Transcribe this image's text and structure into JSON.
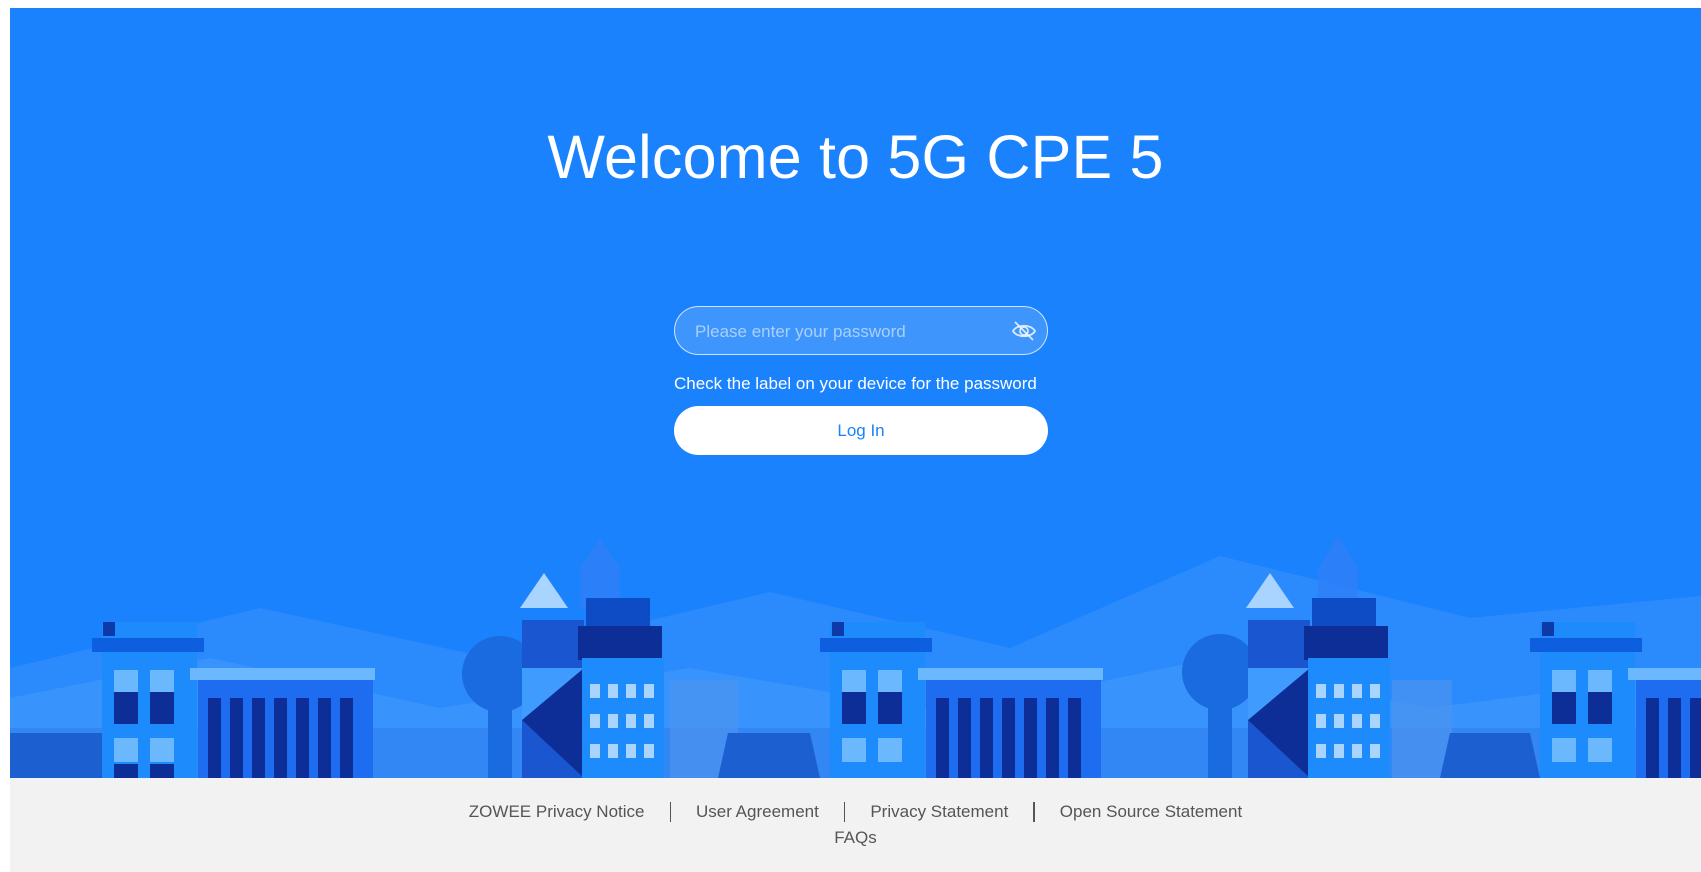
{
  "hero": {
    "title": "Welcome to 5G CPE 5",
    "background_color": "#1a82fc"
  },
  "login_form": {
    "password_placeholder": "Please enter your password",
    "password_value": "",
    "toggle_icon": "eye-slash-icon",
    "hint": "Check the label on your device for the password",
    "login_label": "Log In"
  },
  "footer": {
    "links": [
      "ZOWEE Privacy Notice",
      "User Agreement",
      "Privacy Statement",
      "Open Source Statement"
    ],
    "faqs_label": "FAQs"
  }
}
